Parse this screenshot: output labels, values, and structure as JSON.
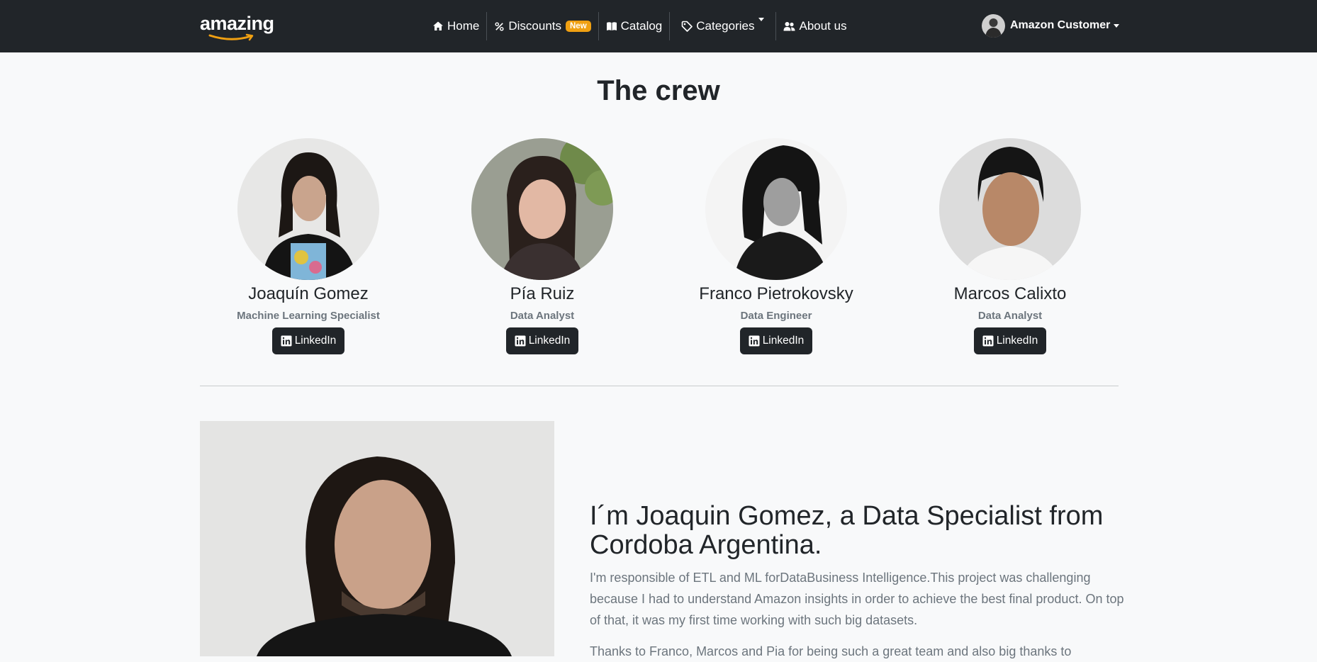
{
  "navbar": {
    "brand": "amazing",
    "links": [
      {
        "label": "Home",
        "icon": "house-icon"
      },
      {
        "label": "Discounts",
        "icon": "percent-icon",
        "badge": "New"
      },
      {
        "label": "Catalog",
        "icon": "book-icon"
      },
      {
        "label": "Categories",
        "icon": "tag-icon"
      },
      {
        "label": "About us",
        "icon": "people-icon"
      }
    ],
    "user": {
      "name": "Amazon Customer"
    },
    "colors": {
      "background": "#212529",
      "badge": "#f0a012"
    }
  },
  "crew": {
    "title": "The crew",
    "members": [
      {
        "name": "Joaquín Gomez",
        "role": "Machine Learning Specialist",
        "button": "LinkedIn"
      },
      {
        "name": "Pía Ruiz",
        "role": "Data Analyst",
        "button": "LinkedIn"
      },
      {
        "name": "Franco Pietrokovsky",
        "role": "Data Engineer",
        "button": "LinkedIn"
      },
      {
        "name": "Marcos Calixto",
        "role": "Data Analyst",
        "button": "LinkedIn"
      }
    ]
  },
  "feature": {
    "heading": "I´m Joaquin Gomez, a Data Specialist from Cordoba Argentina.",
    "paragraph1": "I'm responsible of ETL and ML forDataBusiness Intelligence.This project was challenging because I had to understand Amazon insights in order to achieve the best final product. On top of that, it was my first time working with such big datasets.",
    "paragraph2": "Thanks to Franco, Marcos and Pia for being such a great team and also big thanks to"
  }
}
